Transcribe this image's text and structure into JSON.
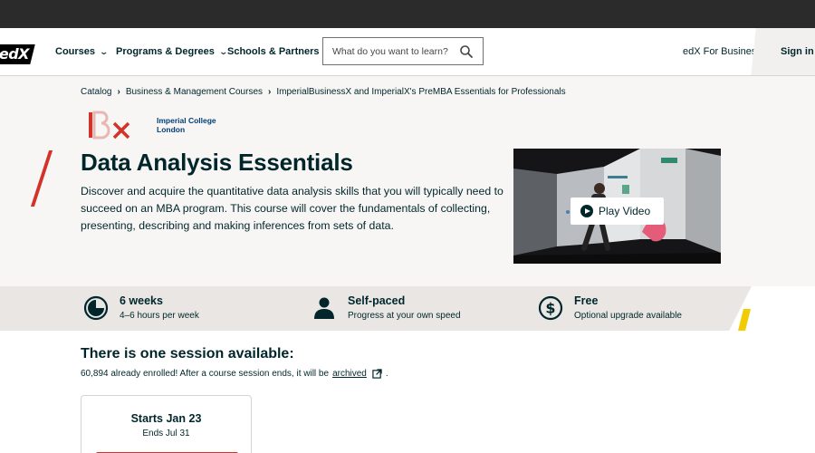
{
  "header": {
    "logo_text": "edX",
    "nav": [
      {
        "label": "Courses"
      },
      {
        "label": "Programs & Degrees"
      },
      {
        "label": "Schools & Partners"
      }
    ],
    "search_placeholder": "What do you want to learn?",
    "business_link": "edX For Business",
    "signin_label": "Sign in"
  },
  "breadcrumb": [
    "Catalog",
    "Business & Management Courses",
    "ImperialBusinessX and ImperialX's PreMBA Essentials for Professionals"
  ],
  "partner": {
    "name_line1": "Imperial College",
    "name_line2": "London"
  },
  "course": {
    "title": "Data Analysis Essentials",
    "description": "Discover and acquire the quantitative data analysis skills that you will typically need to succeed on an MBA program. This course will cover the fundamentals of collecting, presenting, describing and making inferences from sets of data.",
    "play_video_label": "Play Video"
  },
  "facts": [
    {
      "title": "6 weeks",
      "subtitle": "4–6 hours per week",
      "icon": "clock-icon"
    },
    {
      "title": "Self-paced",
      "subtitle": "Progress at your own speed",
      "icon": "person-icon"
    },
    {
      "title": "Free",
      "subtitle": "Optional upgrade available",
      "icon": "dollar-icon"
    }
  ],
  "sessions": {
    "heading": "There is one session available:",
    "enrolled_text": "60,894 already enrolled! After a course session ends, it will be",
    "archived_link": "archived",
    "period": ".",
    "card": {
      "starts": "Starts Jan 23",
      "ends": "Ends Jul 31"
    }
  },
  "colors": {
    "ink": "#00262b",
    "accent_red": "#d23228",
    "accent_yellow": "#f0cc00",
    "hero_bg": "#f8f6f5",
    "facts_bg": "#e9e6e4",
    "imperial_blue": "#003e74"
  }
}
